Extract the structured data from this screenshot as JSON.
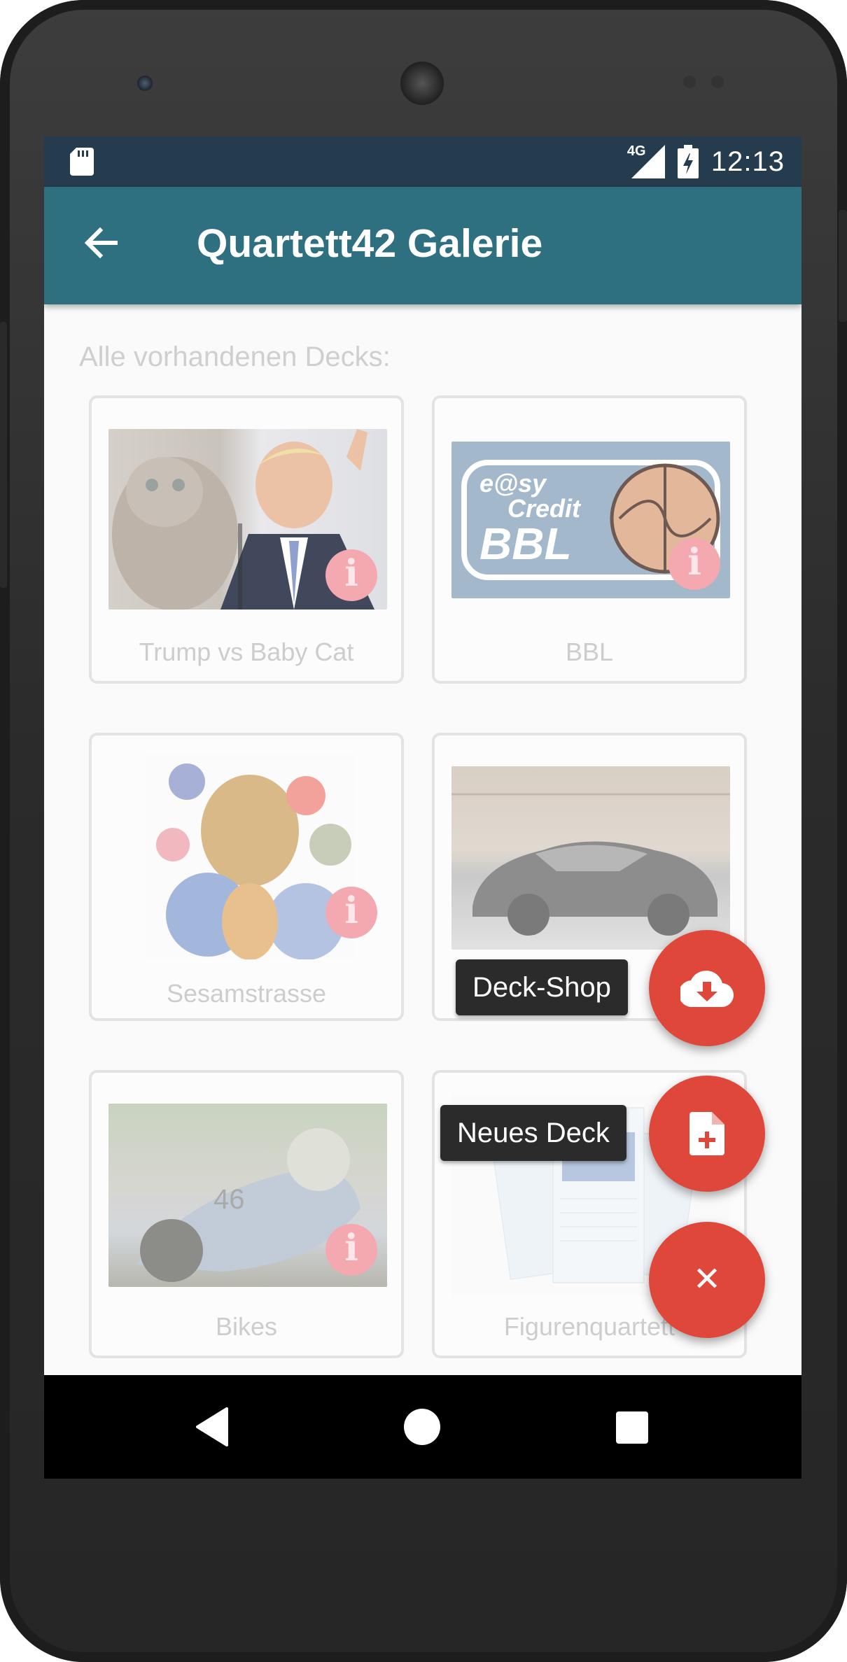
{
  "status_bar": {
    "network": "4G",
    "time": "12:13"
  },
  "app_bar": {
    "title": "Quartett42 Galerie",
    "back_icon": "arrow-back-icon"
  },
  "gallery": {
    "subtitle": "Alle vorhandenen Decks:",
    "decks": [
      {
        "name": "Trump vs Baby Cat",
        "has_info": true
      },
      {
        "name": "BBL",
        "has_info": true
      },
      {
        "name": "Sesamstrasse",
        "has_info": true
      },
      {
        "name": "",
        "has_info": false
      },
      {
        "name": "Bikes",
        "has_info": true
      },
      {
        "name": "Figurenquartett",
        "has_info": false
      }
    ],
    "bbl_logo": {
      "line1": "e@sy",
      "line2": "Credit",
      "line3": "BBL"
    },
    "info_glyph": "i"
  },
  "fab_menu": {
    "shop": {
      "tooltip": "Deck-Shop",
      "icon": "cloud-download-icon"
    },
    "new_deck": {
      "tooltip": "Neues Deck",
      "icon": "file-add-icon"
    },
    "close": {
      "icon": "close-icon",
      "glyph": "✕"
    },
    "color": "#e0473b"
  },
  "colors": {
    "app_bar": "#2f7080",
    "status_bar": "#243c4d"
  }
}
